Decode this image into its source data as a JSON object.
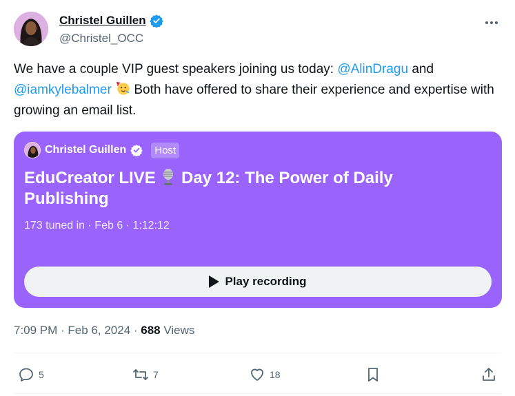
{
  "author": {
    "name": "Christel Guillen",
    "handle": "@Christel_OCC"
  },
  "tweet": {
    "text_1": "We have a couple VIP guest speakers joining us today: ",
    "mention_1": "@AlinDragu",
    "text_2": " and",
    "mention_2": "@iamkylebalmer",
    "text_3": " Both have offered to share their experience and expertise with growing an email list.",
    "emoji": "party-face"
  },
  "space": {
    "host_name": "Christel Guillen",
    "host_badge": "Host",
    "title_1": "EduCreator LIVE ",
    "title_2": " Day 12: The Power of Daily Publishing",
    "meta": "173 tuned in · Feb 6 · 1:12:12",
    "play_label": "Play recording",
    "color": "#9a63fb"
  },
  "meta": {
    "timestamp": "7:09 PM · Feb 6, 2024 · ",
    "views_count": "688",
    "views_label": " Views"
  },
  "actions": {
    "replies": "5",
    "reposts": "7",
    "likes": "18"
  },
  "colors": {
    "accent": "#1d9bf0",
    "text": "#0f1419",
    "muted": "#536471"
  }
}
